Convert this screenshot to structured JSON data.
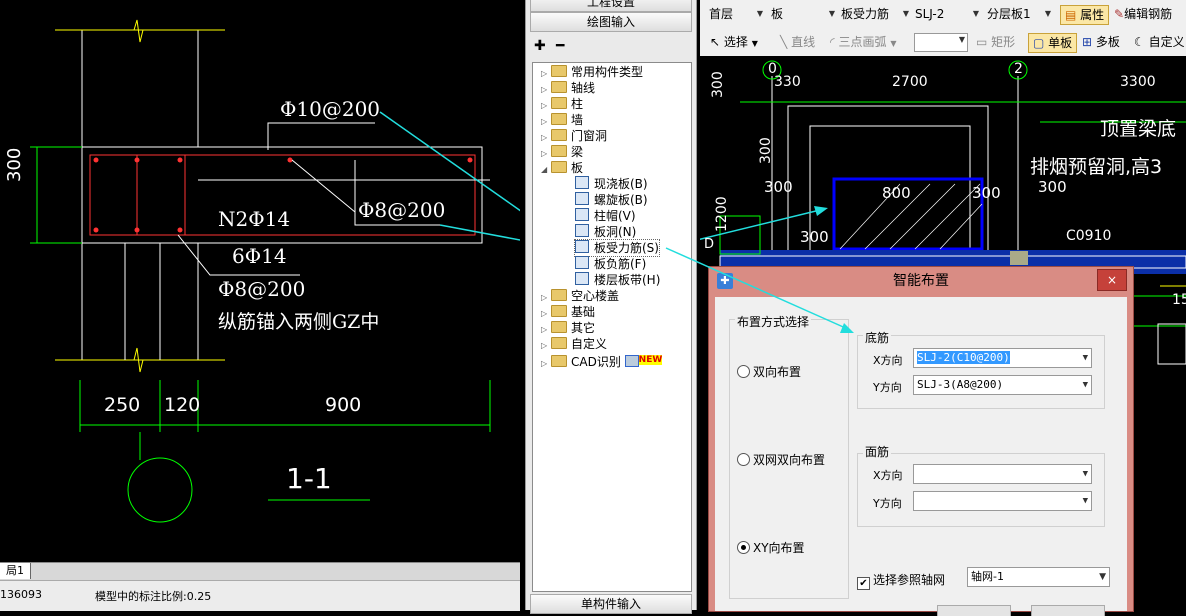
{
  "left_drawing": {
    "callout_top": "Φ10@200",
    "callout_mid": "Φ8@200",
    "note_1": "N2Φ14",
    "note_2": "6Φ14",
    "note_3": "Φ8@200",
    "note_4": "纵筋锚入两侧GZ中",
    "dim_height": "300",
    "dim_250": "250",
    "dim_120": "120",
    "dim_900": "900",
    "section_label": "1-1"
  },
  "left_bottom": {
    "tab_label": "局1",
    "coord": "136093",
    "status_text": "模型中的标注比例:0.25"
  },
  "mid_panel": {
    "header_top": "工程设置",
    "header_draw": "绘图输入",
    "footer": "单构件输入",
    "tree_items": [
      "常用构件类型",
      "轴线",
      "柱",
      "墙",
      "门窗洞",
      "梁",
      "板",
      "现浇板(B)",
      "螺旋板(B)",
      "柱帽(V)",
      "板洞(N)",
      "板受力筋(S)",
      "板负筋(F)",
      "楼层板带(H)",
      "空心楼盖",
      "基础",
      "其它",
      "自定义",
      "CAD识别"
    ],
    "new_badge": "NEW"
  },
  "toolbar1": {
    "floor": "首层",
    "component": "板",
    "type": "板受力筋",
    "name": "SLJ-2",
    "layer": "分层板1",
    "prop_btn": "属性",
    "edit_btn": "编辑钢筋"
  },
  "toolbar2": {
    "select_btn": "选择",
    "line_btn": "直线",
    "arc_btn": "三点画弧",
    "rect_btn": "矩形",
    "single_btn": "单板",
    "multi_btn": "多板",
    "custom_btn": "自定义"
  },
  "right_drawing": {
    "axis_0": "0",
    "axis_2": "2",
    "dim_330": "330",
    "dim_2700": "2700",
    "dim_3300": "3300",
    "dim_300a": "300",
    "dim_300b": "300",
    "dim_300c": "300",
    "dim_300d": "300",
    "dim_300e": "300",
    "dim_300f": "300",
    "dim_800": "800",
    "dim_1200": "1200",
    "label_c0910": "C0910",
    "label_d": "D",
    "label_15": "15",
    "note_1": "顶置梁底",
    "note_2": "排烟预留洞,高3"
  },
  "dialog": {
    "title": "智能布置",
    "close": "×",
    "layout_group": "布置方式选择",
    "radio_1": "双向布置",
    "radio_2": "双网双向布置",
    "radio_3": "XY向布置",
    "bottom_group": "底筋",
    "top_group": "面筋",
    "x_dir": "X方向",
    "y_dir": "Y方向",
    "bottom_x_value": "SLJ-2(C10@200)",
    "bottom_y_value": "SLJ-3(A8@200)",
    "top_x_value": "",
    "top_y_value": "",
    "axis_check": "选择参照轴网",
    "axis_value": "轴网-1"
  }
}
